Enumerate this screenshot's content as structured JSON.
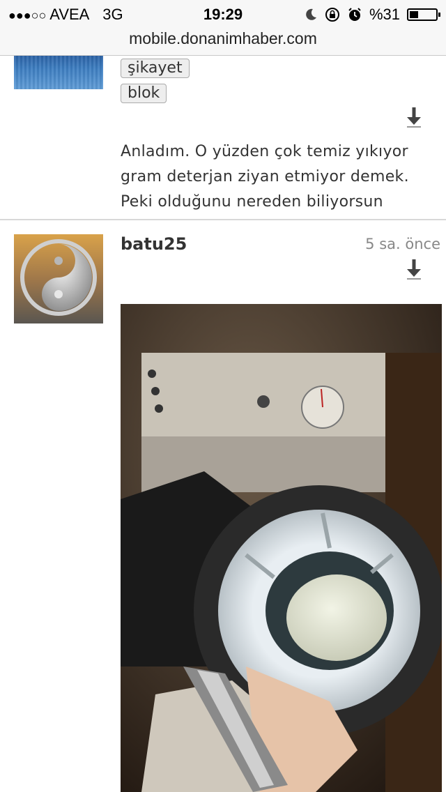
{
  "status_bar": {
    "carrier": "AVEA",
    "network": "3G",
    "time": "19:29",
    "battery": "%31",
    "battery_level": 0.31
  },
  "url_bar": {
    "url": "mobile.donanimhaber.com"
  },
  "post1": {
    "buttons": {
      "complain": "şikayet",
      "block": "blok"
    },
    "text_lines": [
      "Anladım. O yüzden çok temiz yıkıyor",
      "gram deterjan ziyan etmiyor demek.",
      "Peki olduğunu nereden biliyorsun"
    ]
  },
  "post2": {
    "username": "batu25",
    "time_ago": "5 sa. önce"
  },
  "icons": {
    "signal": "signal-dots-icon",
    "moon": "moon-icon",
    "rotation_lock": "rotation-lock-icon",
    "alarm": "alarm-icon",
    "battery": "battery-icon",
    "download": "download-arrow-icon"
  }
}
